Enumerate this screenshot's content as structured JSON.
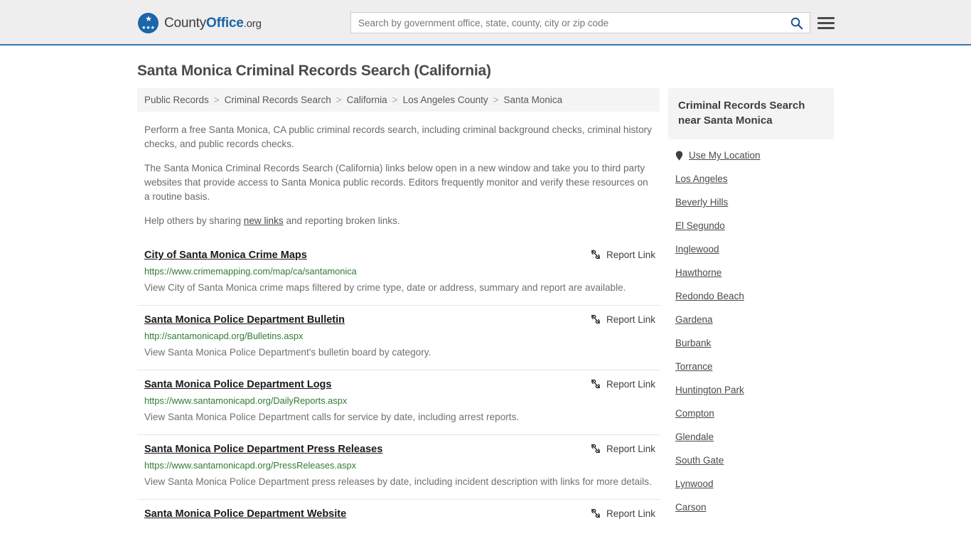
{
  "header": {
    "brand": {
      "part1": "County",
      "part2": "Office",
      "part3": ".org",
      "logo_icon": "eagle-seal-icon"
    },
    "search": {
      "placeholder": "Search by government office, state, county, city or zip code",
      "value": "",
      "icon": "search-icon"
    },
    "menu_icon": "hamburger-menu-icon"
  },
  "page": {
    "title": "Santa Monica Criminal Records Search (California)"
  },
  "breadcrumb": {
    "separator": ">",
    "items": [
      {
        "label": "Public Records"
      },
      {
        "label": "Criminal Records Search"
      },
      {
        "label": "California"
      },
      {
        "label": "Los Angeles County"
      },
      {
        "label": "Santa Monica"
      }
    ]
  },
  "intro": {
    "p1": "Perform a free Santa Monica, CA public criminal records search, including criminal background checks, criminal history checks, and public records checks.",
    "p2": "The Santa Monica Criminal Records Search (California) links below open in a new window and take you to third party websites that provide access to Santa Monica public records. Editors frequently monitor and verify these resources on a routine basis.",
    "p3_before": "Help others by sharing ",
    "p3_link": "new links",
    "p3_after": " and reporting broken links."
  },
  "report_link": {
    "label": "Report Link",
    "icon": "broken-link-icon"
  },
  "results": [
    {
      "title": "City of Santa Monica Crime Maps",
      "url": "https://www.crimemapping.com/map/ca/santamonica",
      "description": "View City of Santa Monica crime maps filtered by crime type, date or address, summary and report are available."
    },
    {
      "title": "Santa Monica Police Department Bulletin",
      "url": "http://santamonicapd.org/Bulletins.aspx",
      "description": "View Santa Monica Police Department's bulletin board by category."
    },
    {
      "title": "Santa Monica Police Department Logs",
      "url": "https://www.santamonicapd.org/DailyReports.aspx",
      "description": "View Santa Monica Police Department calls for service by date, including arrest reports."
    },
    {
      "title": "Santa Monica Police Department Press Releases",
      "url": "https://www.santamonicapd.org/PressReleases.aspx",
      "description": "View Santa Monica Police Department press releases by date, including incident description with links for more details."
    },
    {
      "title": "Santa Monica Police Department Website",
      "url": "",
      "description": ""
    }
  ],
  "sidebar": {
    "heading": "Criminal Records Search near Santa Monica",
    "use_my_location": {
      "label": "Use My Location",
      "icon": "map-pin-icon"
    },
    "cities": [
      {
        "label": "Los Angeles"
      },
      {
        "label": "Beverly Hills"
      },
      {
        "label": "El Segundo"
      },
      {
        "label": "Inglewood"
      },
      {
        "label": "Hawthorne"
      },
      {
        "label": "Redondo Beach"
      },
      {
        "label": "Gardena"
      },
      {
        "label": "Burbank"
      },
      {
        "label": "Torrance"
      },
      {
        "label": "Huntington Park"
      },
      {
        "label": "Compton"
      },
      {
        "label": "Glendale"
      },
      {
        "label": "South Gate"
      },
      {
        "label": "Lynwood"
      },
      {
        "label": "Carson"
      }
    ]
  },
  "colors": {
    "brand_blue": "#1b65a8",
    "header_bg": "#eeeeee",
    "header_border": "#3a77b5",
    "url_green": "#2e7d32",
    "panel_gray": "#f4f4f4"
  }
}
